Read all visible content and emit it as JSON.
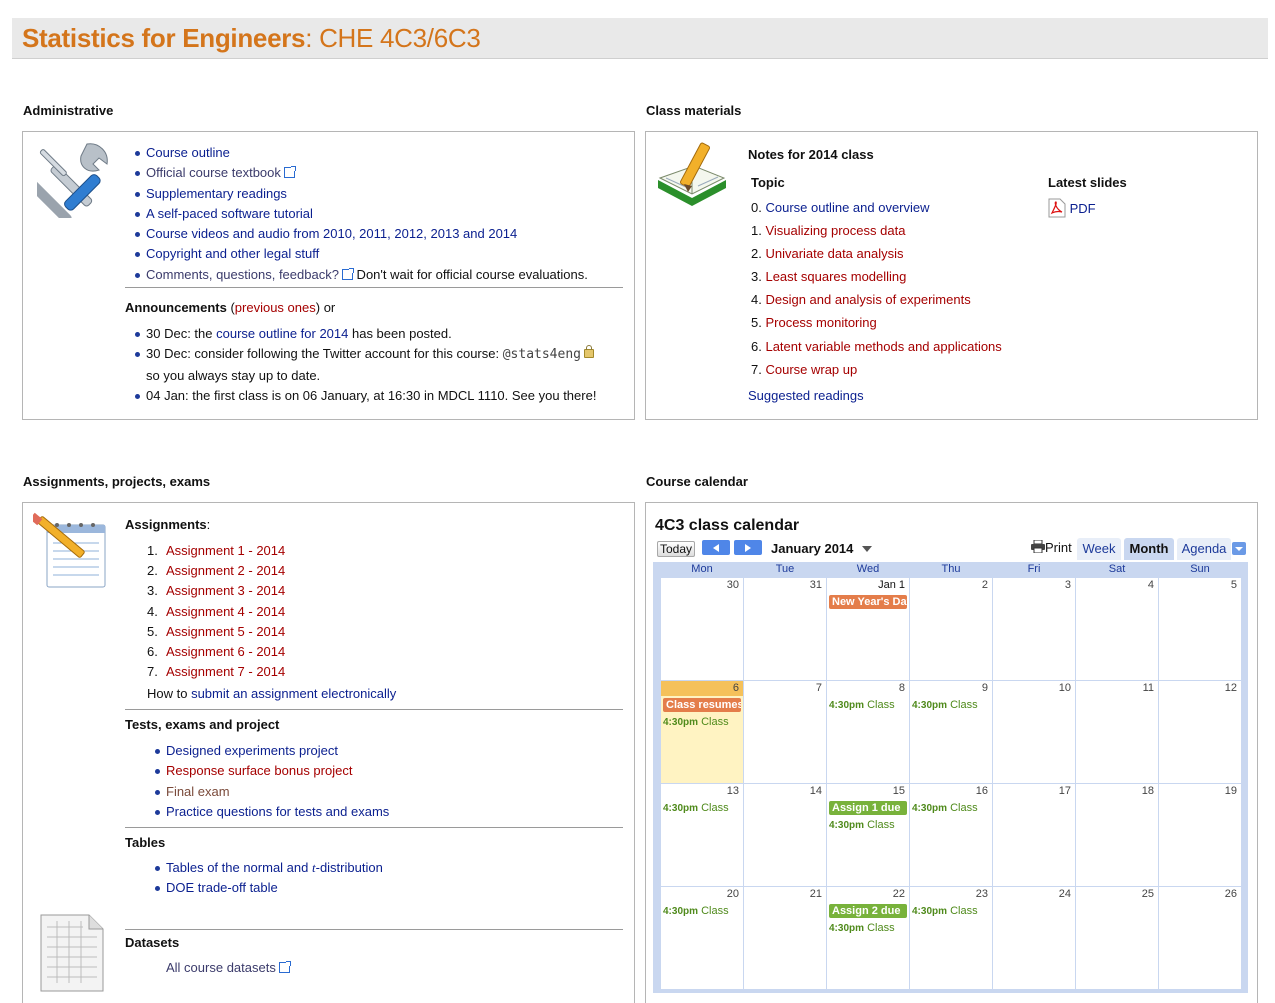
{
  "header": {
    "title_bold": "Statistics for Engineers",
    "title_rest": ": CHE 4C3/6C3"
  },
  "admin": {
    "heading": "Administrative",
    "links": [
      {
        "text": "Course outline",
        "ext": false
      },
      {
        "text": "Official course textbook",
        "ext": true
      },
      {
        "text": "Supplementary readings",
        "ext": false
      },
      {
        "text": "A self-paced software tutorial",
        "ext": false
      },
      {
        "text": "Course videos and audio from 2010, 2011, 2012, 2013 and 2014",
        "ext": false
      },
      {
        "text": "Copyright and other legal stuff",
        "ext": false
      }
    ],
    "feedback_link": "Comments, questions, feedback?",
    "feedback_after": " Don't wait for official course evaluations.",
    "ann_heading": "Announcements",
    "ann_prev_open": " (",
    "ann_prev_link": "previous ones",
    "ann_prev_close": ") or",
    "ann1_pre": "30 Dec: the ",
    "ann1_link": "course outline for 2014",
    "ann1_post": " has been posted.",
    "ann2_pre": "30 Dec: consider following the Twitter account for this course: ",
    "ann2_handle": "@stats4eng",
    "ann2_post": "so you always stay up to date.",
    "ann3": "04 Jan: the first class is on 06 January, at 16:30 in MDCL 1110. See you there!"
  },
  "materials": {
    "heading": "Class materials",
    "notes_heading": "Notes for 2014 class",
    "topic_label": "Topic",
    "slides_label": "Latest slides",
    "pdf_label": "PDF",
    "topics": [
      {
        "n": "0.",
        "text": "Course outline and overview",
        "color": "blue"
      },
      {
        "n": "1.",
        "text": "Visualizing process data",
        "color": "red"
      },
      {
        "n": "2.",
        "text": "Univariate data analysis",
        "color": "red"
      },
      {
        "n": "3.",
        "text": "Least squares modelling",
        "color": "red"
      },
      {
        "n": "4.",
        "text": "Design and analysis of experiments",
        "color": "red"
      },
      {
        "n": "5.",
        "text": "Process monitoring",
        "color": "red"
      },
      {
        "n": "6.",
        "text": "Latent variable methods and applications",
        "color": "red"
      },
      {
        "n": "7.",
        "text": "Course wrap up",
        "color": "red"
      }
    ],
    "suggested": "Suggested readings"
  },
  "assignments": {
    "heading": "Assignments, projects, exams",
    "assign_label": "Assignments",
    "assign_colon": ":",
    "items": [
      {
        "n": "1.",
        "text": "Assignment 1 - 2014"
      },
      {
        "n": "2.",
        "text": "Assignment 2 - 2014"
      },
      {
        "n": "3.",
        "text": "Assignment 3 - 2014"
      },
      {
        "n": "4.",
        "text": "Assignment 4 - 2014"
      },
      {
        "n": "5.",
        "text": "Assignment 5 - 2014"
      },
      {
        "n": "6.",
        "text": "Assignment 6 - 2014"
      },
      {
        "n": "7.",
        "text": "Assignment 7 - 2014"
      }
    ],
    "howto_pre": "How to ",
    "howto_link": "submit an assignment electronically",
    "tests_heading": "Tests, exams and project",
    "tests": [
      {
        "text": "Designed experiments project",
        "color": "blue"
      },
      {
        "text": "Response surface bonus project",
        "color": "red"
      },
      {
        "text": "Final exam",
        "color": "brown"
      },
      {
        "text": "Practice questions for tests and exams",
        "color": "blue"
      }
    ],
    "tables_heading": "Tables",
    "tables_1a": "Tables of the normal and ",
    "tables_1t": "t",
    "tables_1b": "-distribution",
    "tables_2": "DOE trade-off table",
    "datasets_heading": "Datasets",
    "datasets_link": "All course datasets"
  },
  "calendar": {
    "heading": "Course calendar",
    "title": "4C3 class calendar",
    "today": "Today",
    "month": "January 2014",
    "print": "Print",
    "tabs": [
      "Week",
      "Month",
      "Agenda"
    ],
    "daynames": [
      "Mon",
      "Tue",
      "Wed",
      "Thu",
      "Fri",
      "Sat",
      "Sun"
    ],
    "weeks": [
      [
        "30",
        "31",
        "Jan 1",
        "2",
        "3",
        "4",
        "5"
      ],
      [
        "6",
        "7",
        "8",
        "9",
        "10",
        "11",
        "12"
      ],
      [
        "13",
        "14",
        "15",
        "16",
        "17",
        "18",
        "19"
      ],
      [
        "20",
        "21",
        "22",
        "23",
        "24",
        "25",
        "26"
      ]
    ],
    "ev_newyear": "New Year's Day",
    "ev_resume": "Class resumes",
    "ev_assign1": "Assign 1 due",
    "ev_assign2": "Assign 2 due",
    "ev_time": "4:30pm",
    "ev_class": "Class",
    "colors": {
      "orange": "#e47d4a",
      "green": "#78b23b",
      "today": "#fff3c2"
    }
  }
}
